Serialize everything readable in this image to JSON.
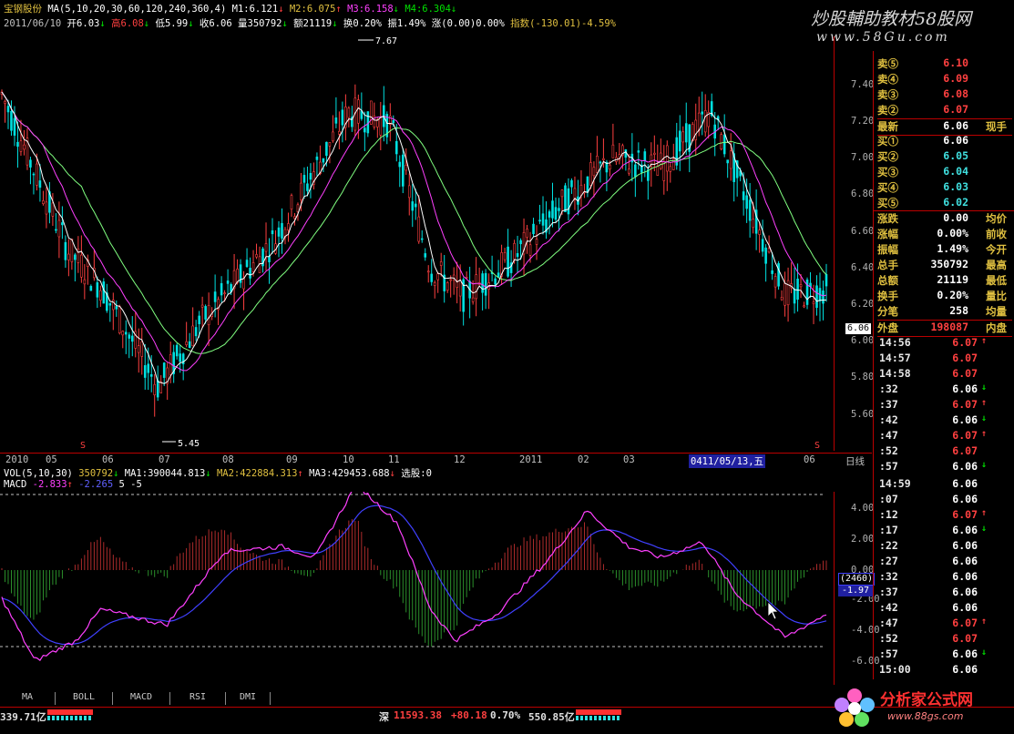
{
  "header": {
    "stock_name": "宝钢股份",
    "ma_label": "MA(5,10,20,30,60,120,240,360,4)",
    "m1": "M1:6.121",
    "m2": "M2:6.075",
    "m3": "M3:6.158",
    "m4": "M4:6.304",
    "date": "2011/06/10",
    "open": "开6.03",
    "high": "高6.08",
    "low": "低5.99",
    "close": "收6.06",
    "volume": "量350792",
    "amount": "额21119",
    "turnover": "换0.20%",
    "amplitude": "振1.49%",
    "change": "涨(0.00)0.00%",
    "index": "指数(-130.01)-4.59%"
  },
  "watermark": {
    "line1": "炒股輔助教材58股网",
    "line2": "www.58Gu.com"
  },
  "price_axis": {
    "ticks": [
      "7.40",
      "7.20",
      "7.00",
      "6.80",
      "6.60",
      "6.40",
      "6.20",
      "6.00",
      "5.80",
      "5.60"
    ],
    "current_tag": "6.06"
  },
  "annotations": {
    "high_label": "7.67",
    "low_label": "5.45"
  },
  "date_axis": {
    "ticks": [
      "2010",
      "05",
      "06",
      "07",
      "08",
      "09",
      "10",
      "11",
      "12",
      "2011",
      "02",
      "03",
      "0411/05/13,五",
      "06"
    ],
    "period": "日线"
  },
  "volume": {
    "label": "VOL(5,10,30)",
    "value": "350792",
    "ma1": "MA1:390044.813",
    "ma2": "MA2:422884.313",
    "ma3": "MA3:429453.688",
    "extra": "选股:0"
  },
  "macd": {
    "label": "MACD",
    "diff": "-2.833",
    "dea": "-2.265",
    "extra": "5 -5",
    "ticks": [
      "4.00",
      "2.00",
      "0.00",
      "-2.00",
      "-4.00",
      "-6.00"
    ],
    "tag_top": "(2460)",
    "tag_bottom": "-1.97"
  },
  "quotes": {
    "sell": [
      {
        "label": "卖⑤",
        "price": "6.10"
      },
      {
        "label": "卖④",
        "price": "6.09"
      },
      {
        "label": "卖③",
        "price": "6.08"
      },
      {
        "label": "卖②",
        "price": "6.07"
      }
    ],
    "latest": {
      "label": "最新",
      "price": "6.06",
      "extra": "现手"
    },
    "buy": [
      {
        "label": "买①",
        "price": "6.06"
      },
      {
        "label": "买②",
        "price": "6.05"
      },
      {
        "label": "买③",
        "price": "6.04"
      },
      {
        "label": "买④",
        "price": "6.03"
      },
      {
        "label": "买⑤",
        "price": "6.02"
      }
    ],
    "stats": [
      {
        "label": "涨跌",
        "value": "0.00",
        "extra": "均价"
      },
      {
        "label": "涨幅",
        "value": "0.00%",
        "extra": "前收"
      },
      {
        "label": "振幅",
        "value": "1.49%",
        "extra": "今开"
      },
      {
        "label": "总手",
        "value": "350792",
        "extra": "最高"
      },
      {
        "label": "总额",
        "value": "21119",
        "extra": "最低"
      },
      {
        "label": "换手",
        "value": "0.20%",
        "extra": "量比"
      },
      {
        "label": "分笔",
        "value": "258",
        "extra": "均量"
      }
    ],
    "outer_inner": {
      "label": "外盘",
      "value": "198087",
      "extra": "内盘"
    }
  },
  "ticks": [
    {
      "time": "14:56",
      "price": "6.07",
      "dir": "up"
    },
    {
      "time": "14:57",
      "price": "6.07",
      "dir": ""
    },
    {
      "time": "14:58",
      "price": "6.07",
      "dir": ""
    },
    {
      "time": ":32",
      "price": "6.06",
      "dir": "down"
    },
    {
      "time": ":37",
      "price": "6.07",
      "dir": "up"
    },
    {
      "time": ":42",
      "price": "6.06",
      "dir": "down"
    },
    {
      "time": ":47",
      "price": "6.07",
      "dir": "up"
    },
    {
      "time": ":52",
      "price": "6.07",
      "dir": ""
    },
    {
      "time": ":57",
      "price": "6.06",
      "dir": "down"
    },
    {
      "time": "14:59",
      "price": "6.06",
      "dir": ""
    },
    {
      "time": ":07",
      "price": "6.06",
      "dir": ""
    },
    {
      "time": ":12",
      "price": "6.07",
      "dir": "up"
    },
    {
      "time": ":17",
      "price": "6.06",
      "dir": "down"
    },
    {
      "time": ":22",
      "price": "6.06",
      "dir": ""
    },
    {
      "time": ":27",
      "price": "6.06",
      "dir": ""
    },
    {
      "time": ":32",
      "price": "6.06",
      "dir": ""
    },
    {
      "time": ":37",
      "price": "6.06",
      "dir": ""
    },
    {
      "time": ":42",
      "price": "6.06",
      "dir": ""
    },
    {
      "time": ":47",
      "price": "6.07",
      "dir": "up"
    },
    {
      "time": ":52",
      "price": "6.07",
      "dir": ""
    },
    {
      "time": ":57",
      "price": "6.06",
      "dir": "down"
    },
    {
      "time": "15:00",
      "price": "6.06",
      "dir": ""
    }
  ],
  "tabs": [
    "MA",
    "BOLL",
    "MACD",
    "RSI",
    "DMI"
  ],
  "status": {
    "left_amount": "339.71亿",
    "sz_label": "深",
    "sz_index": "11593.38",
    "sz_change": "+80.18",
    "sz_pct": "0.70%",
    "sz_amount": "550.85亿",
    "logo_text": "分析家公式网",
    "logo_url": "www.88gs.com"
  },
  "colors": {
    "up": "#ff4040",
    "down": "#00e0e0",
    "ma_white": "#ffffff",
    "ma_magenta": "#ff40ff",
    "ma_green": "#80ff80"
  }
}
